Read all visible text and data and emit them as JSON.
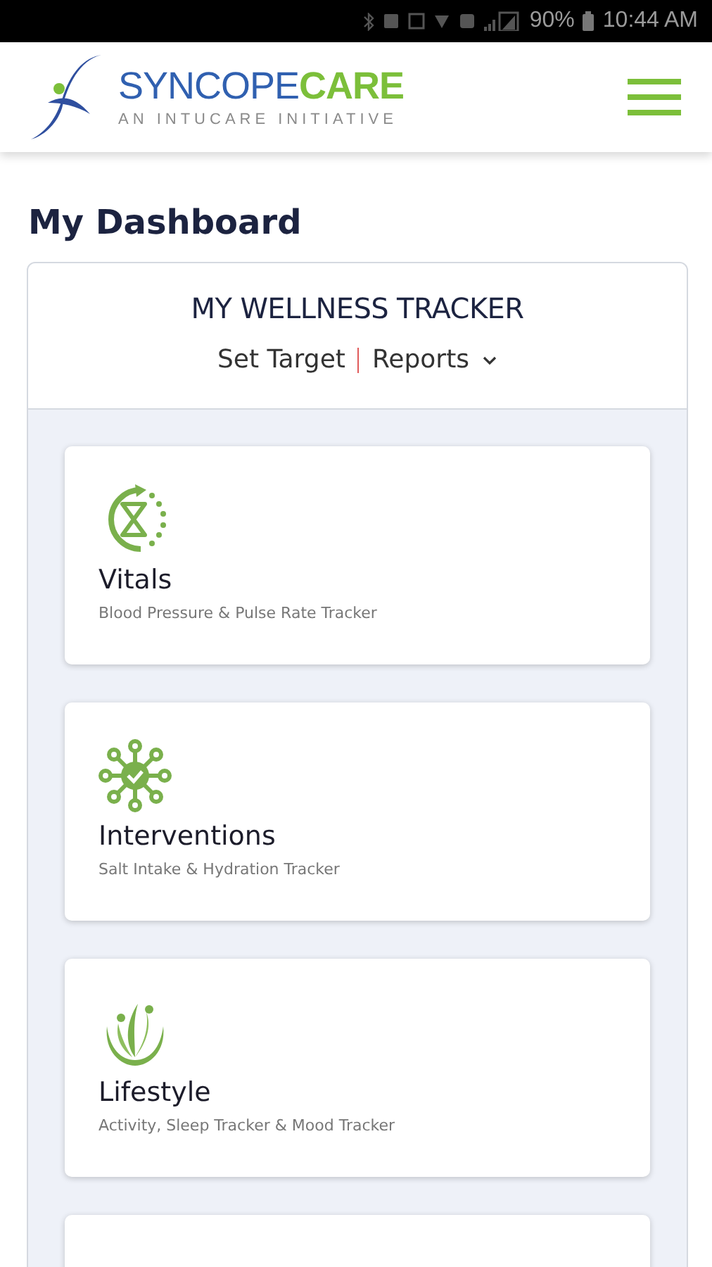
{
  "status_bar": {
    "battery": "90%",
    "time": "10:44 AM"
  },
  "header": {
    "brand": {
      "primary": "SYNCOPE",
      "accent": "CARE"
    },
    "tagline": "AN INTUCARE INITIATIVE"
  },
  "page_title": "My Dashboard",
  "tracker": {
    "title": "MY WELLNESS TRACKER",
    "links": [
      {
        "label": "Set Target",
        "dropdown": false
      },
      {
        "label": "Reports",
        "dropdown": true
      }
    ],
    "tiles": [
      {
        "kind": "vitals",
        "title": "Vitals",
        "subtitle": "Blood Pressure & Pulse Rate Tracker"
      },
      {
        "kind": "interventions",
        "title": "Interventions",
        "subtitle": "Salt Intake & Hydration Tracker"
      },
      {
        "kind": "lifestyle",
        "title": "Lifestyle",
        "subtitle": "Activity, Sleep Tracker & Mood Tracker"
      }
    ]
  }
}
